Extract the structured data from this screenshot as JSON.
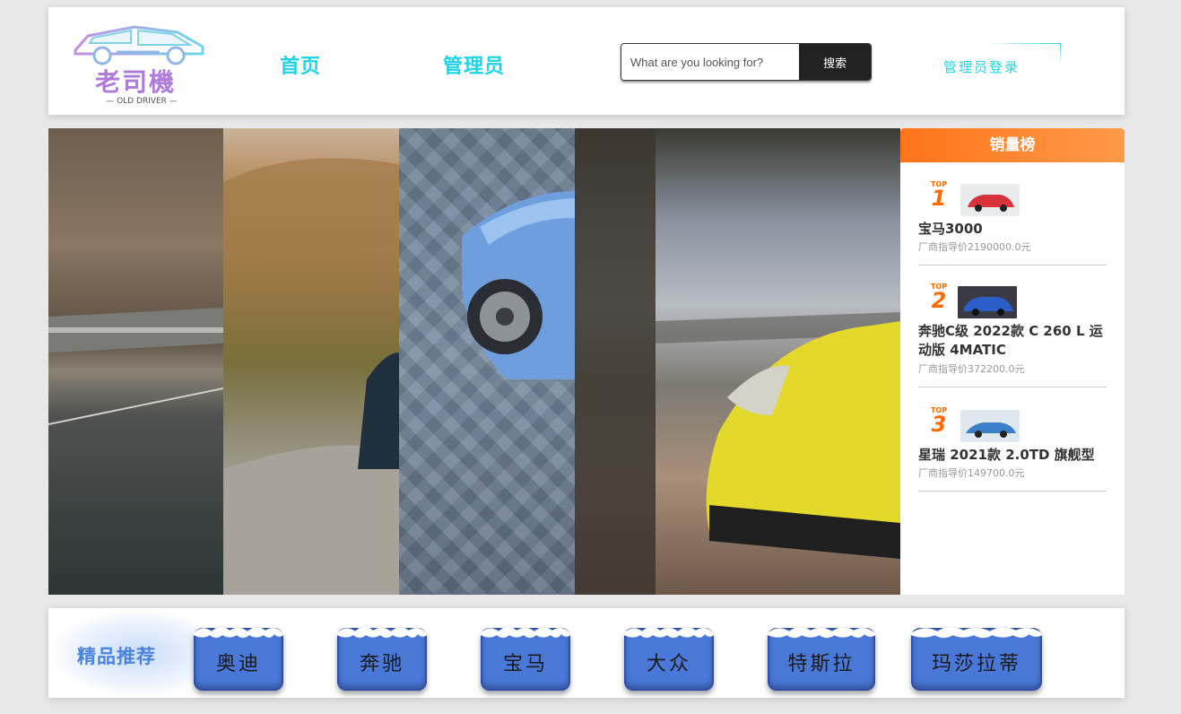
{
  "logo": {
    "text": "老司機",
    "subtitle": "— OLD DRIVER —"
  },
  "nav": {
    "home": "首页",
    "admin": "管理员"
  },
  "search": {
    "placeholder": "What are you looking for?",
    "button": "搜索"
  },
  "login": {
    "label": "管理员登录"
  },
  "ranking": {
    "title": "销量榜",
    "items": [
      {
        "badge": "TOP",
        "rank": "1",
        "name": "宝马3000",
        "price": "厂商指导价2190000.0元",
        "thumb_color": "#d8323a"
      },
      {
        "badge": "TOP",
        "rank": "2",
        "name": "奔驰C级 2022款 C 260 L 运动版 4MATIC",
        "price": "厂商指导价372200.0元",
        "thumb_color": "#2b5fc7"
      },
      {
        "badge": "TOP",
        "rank": "3",
        "name": "星瑞 2021款 2.0TD 旗舰型",
        "price": "厂商指导价149700.0元",
        "thumb_color": "#3b7fc9"
      }
    ]
  },
  "recommend": {
    "title": "精品推荐",
    "brands": [
      "奥迪",
      "奔驰",
      "宝马",
      "大众",
      "特斯拉",
      "玛莎拉蒂"
    ]
  },
  "colors": {
    "accent": "#1fd4e6",
    "ranking_header": "#ff7318",
    "brand_button": "#4a78d8",
    "recommend_title": "#4a84e0"
  }
}
